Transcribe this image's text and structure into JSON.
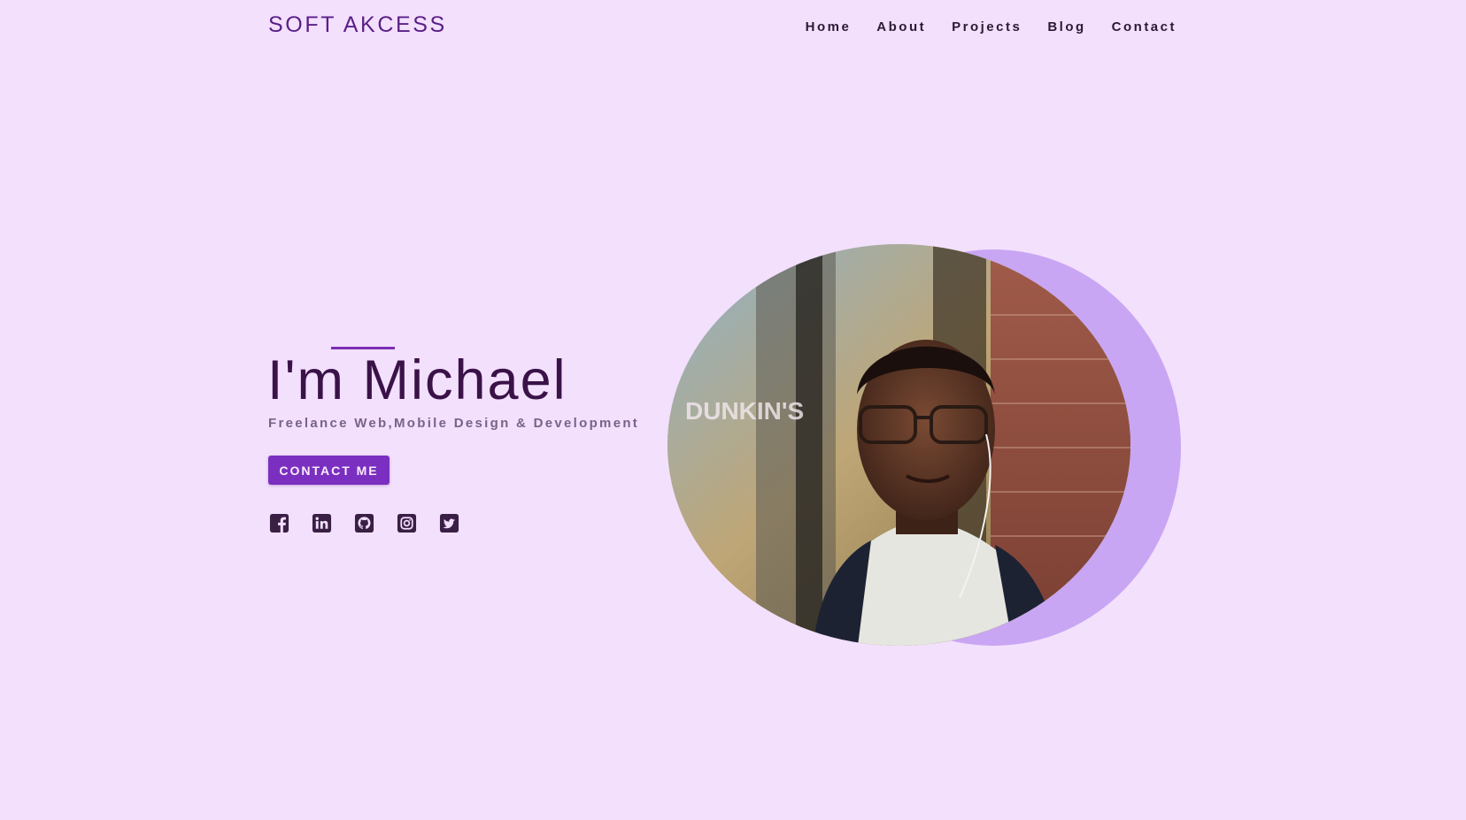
{
  "header": {
    "brand": "SOFT AKCESS",
    "nav": [
      "Home",
      "About",
      "Projects",
      "Blog",
      "Contact"
    ]
  },
  "hero": {
    "title": "I'm Michael",
    "subtitle": "Freelance Web,Mobile Design & Development",
    "cta_label": "CONTACT ME",
    "socials": [
      "facebook-icon",
      "linkedin-icon",
      "github-icon",
      "instagram-icon",
      "twitter-icon"
    ],
    "sign_text": "DUNKIN'S"
  },
  "colors": {
    "background": "#f3e0fd",
    "brand": "#5a1f86",
    "accent": "#7b2fc0",
    "crescent": "#c9a6f3",
    "heading": "#3a1248",
    "subtitle": "#7a6288",
    "icon": "#3a1f45"
  }
}
